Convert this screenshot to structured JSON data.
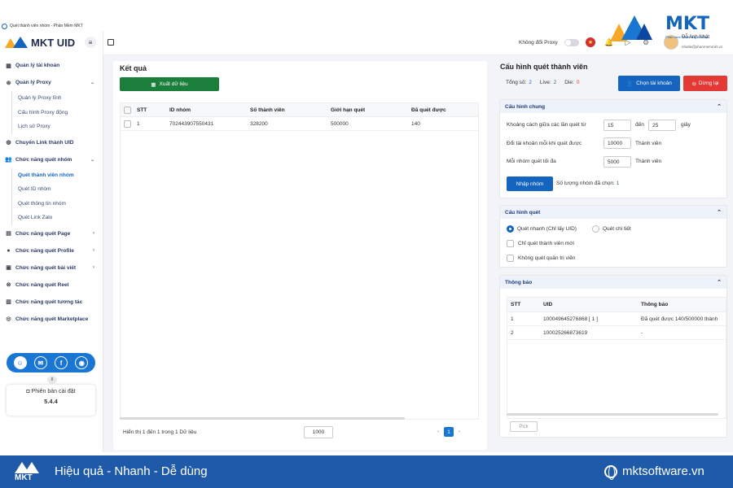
{
  "window": {
    "title": "Quét thành viên nhóm - Phần Mềm MKT"
  },
  "app": {
    "logo_text": "MKT UID"
  },
  "sidebar": {
    "items": [
      {
        "label": "Quản lý tài khoản"
      },
      {
        "label": "Quản lý Proxy"
      },
      {
        "label": "Chuyển Link thành UID"
      },
      {
        "label": "Chức năng quét nhóm"
      },
      {
        "label": "Chức năng quét Page"
      },
      {
        "label": "Chức năng quét Profile"
      },
      {
        "label": "Chức năng quét bài viết"
      },
      {
        "label": "Chức năng quét Reel"
      },
      {
        "label": "Chức năng quét tương tác"
      },
      {
        "label": "Chức năng quét Marketplace"
      }
    ],
    "proxy_sub": [
      "Quản lý Proxy tĩnh",
      "Cấu hình Proxy động",
      "Lịch sử Proxy"
    ],
    "group_sub": [
      "Quét thành viên nhóm",
      "Quét ID nhóm",
      "Quét thông tin nhóm",
      "Quét Link Zalo"
    ],
    "badge": "8",
    "version_label": "Phiên bản cài đặt",
    "version": "5.4.4"
  },
  "topbar": {
    "proxy_toggle_label": "Không đổi Proxy",
    "user_name": "Đỗ Anh Nhật",
    "user_email": "nhatla@phanmemmkt.vn"
  },
  "brand": {
    "name": "MKT",
    "tagline": "Phần mềm Marketing đa kênh"
  },
  "results": {
    "title": "Kết quả",
    "export_label": "Xuất dữ liệu",
    "columns": [
      "STT",
      "ID nhóm",
      "Số thành viên",
      "Giới hạn quét",
      "Đã quét được"
    ],
    "rows": [
      [
        "1",
        "702443907550431",
        "328200",
        "500000",
        "140"
      ]
    ],
    "footer": "Hiển thị 1 đến 1 trong 1 Dữ liệu",
    "page_size": "1000",
    "current_page": "1"
  },
  "config": {
    "title": "Cấu hình quét thành viên",
    "total_label": "Tổng số:",
    "total": "2",
    "live_label": "Live:",
    "live": "2",
    "die_label": "Die:",
    "die": "0",
    "choose_account": "Chọn tài khoản",
    "stop": "Dừng lại",
    "general": {
      "title": "Cấu hình chung",
      "delay_label": "Khoảng cách giữa các lần quét từ",
      "delay_from": "15",
      "delay_to_label": "đến",
      "delay_to": "25",
      "delay_unit": "giây",
      "switch_label": "Đổi tài khoản mỗi khi quét được",
      "switch_value": "10000",
      "switch_unit": "Thành viên",
      "max_label": "Mỗi nhóm quét tối đa",
      "max_value": "5000",
      "max_unit": "Thành viên",
      "import_label": "Nhập nhóm",
      "selected_label": "Số lượng nhóm đã chọn:",
      "selected_count": "1"
    },
    "scan": {
      "title": "Cấu hình quét",
      "opt_fast": "Quét nhanh (Chỉ lấy UID)",
      "opt_detail": "Quét chi tiết",
      "only_new": "Chỉ quét thành viên mới",
      "no_admin": "Không quét quản trị viên"
    },
    "notify": {
      "title": "Thông báo",
      "columns": [
        "STT",
        "UID",
        "Thông báo"
      ],
      "rows": [
        [
          "1",
          "100049645276868 [ 1 ]",
          "Đã quét được 140/500000 thành"
        ],
        [
          "2",
          "100025266873619",
          "-"
        ]
      ],
      "pick_label": "Pick"
    }
  },
  "footer_bar": {
    "logo": "MKT",
    "slogan": "Hiệu quả - Nhanh - Dễ dùng",
    "site": "mktsoftware.vn"
  },
  "colors": {
    "primary": "#1565c0",
    "export_green": "#1b7f3b",
    "stop_red": "#e53935",
    "bottom_bar": "#1e5aa8",
    "brand_yellow": "#f9a825"
  }
}
